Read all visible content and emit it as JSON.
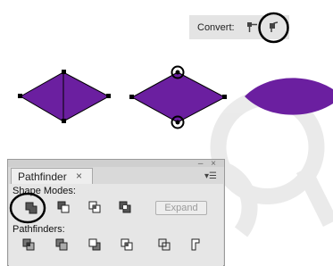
{
  "convert_bar": {
    "label": "Convert:",
    "buttons": [
      {
        "icon": "corner-anchor-icon",
        "selected": false
      },
      {
        "icon": "smooth-anchor-icon",
        "selected": true
      }
    ]
  },
  "artwork": {
    "accent_color": "#6b1fa0",
    "shapes": [
      "diamond-with-divider",
      "diamond-with-anchor-points",
      "rounded-leaf-shape"
    ]
  },
  "pathfinder_panel": {
    "tab_label": "Pathfinder",
    "tab_close": "×",
    "window_controls": "– ×",
    "shape_modes_label": "Shape Modes:",
    "pathfinders_label": "Pathfinders:",
    "expand_label": "Expand",
    "shape_mode_icons": [
      "unite-icon",
      "minus-front-icon",
      "intersect-icon",
      "exclude-icon"
    ],
    "pathfinder_icons": [
      "divide-icon",
      "trim-icon",
      "merge-icon",
      "crop-icon",
      "outline-icon",
      "minus-back-icon"
    ]
  },
  "annotation": {
    "highlight_color": "#000000"
  }
}
